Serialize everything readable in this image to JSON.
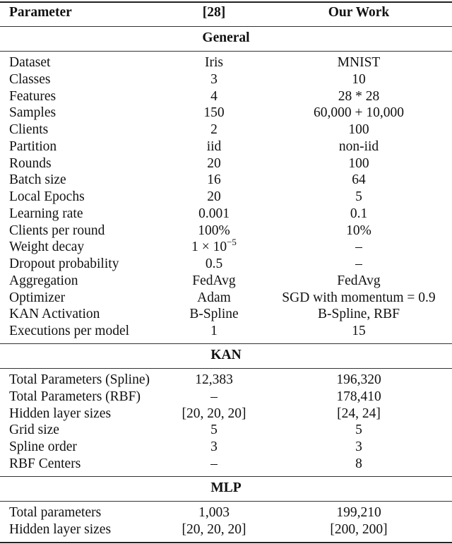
{
  "header": {
    "col1": "Parameter",
    "col2": "[28]",
    "col3": "Our Work"
  },
  "sections": [
    {
      "title": "General",
      "rows": [
        {
          "param": "Dataset",
          "ref": "Iris",
          "ours": "MNIST"
        },
        {
          "param": "Classes",
          "ref": "3",
          "ours": "10"
        },
        {
          "param": "Features",
          "ref": "4",
          "ours": "28 * 28"
        },
        {
          "param": "Samples",
          "ref": "150",
          "ours": "60,000 + 10,000"
        },
        {
          "param": "Clients",
          "ref": "2",
          "ours": "100"
        },
        {
          "param": "Partition",
          "ref": "iid",
          "ours": "non-iid"
        },
        {
          "param": "Rounds",
          "ref": "20",
          "ours": "100"
        },
        {
          "param": "Batch size",
          "ref": "16",
          "ours": "64"
        },
        {
          "param": "Local Epochs",
          "ref": "20",
          "ours": "5"
        },
        {
          "param": "Learning rate",
          "ref": "0.001",
          "ours": "0.1"
        },
        {
          "param": "Clients per round",
          "ref": "100%",
          "ours": "10%"
        },
        {
          "param": "Weight decay",
          "ref": "1 × 10",
          "ref_exp": "−5",
          "ours": "–"
        },
        {
          "param": "Dropout probability",
          "ref": "0.5",
          "ours": "–"
        },
        {
          "param": "Aggregation",
          "ref": "FedAvg",
          "ours": "FedAvg"
        },
        {
          "param": "Optimizer",
          "ref": "Adam",
          "ours": "SGD with momentum = 0.9"
        },
        {
          "param": "KAN Activation",
          "ref": "B-Spline",
          "ours": "B-Spline, RBF"
        },
        {
          "param": "Executions per model",
          "ref": "1",
          "ours": "15"
        }
      ]
    },
    {
      "title": "KAN",
      "rows": [
        {
          "param": "Total Parameters (Spline)",
          "ref": "12,383",
          "ours": "196,320"
        },
        {
          "param": "Total Parameters (RBF)",
          "ref": "–",
          "ours": "178,410"
        },
        {
          "param": "Hidden layer sizes",
          "ref": "[20, 20, 20]",
          "ours": "[24, 24]"
        },
        {
          "param": "Grid size",
          "ref": "5",
          "ours": "5"
        },
        {
          "param": "Spline order",
          "ref": "3",
          "ours": "3"
        },
        {
          "param": "RBF Centers",
          "ref": "–",
          "ours": "8"
        }
      ]
    },
    {
      "title": "MLP",
      "rows": [
        {
          "param": "Total parameters",
          "ref": "1,003",
          "ours": "199,210"
        },
        {
          "param": "Hidden layer sizes",
          "ref": "[20, 20, 20]",
          "ours": "[200, 200]"
        }
      ]
    }
  ]
}
